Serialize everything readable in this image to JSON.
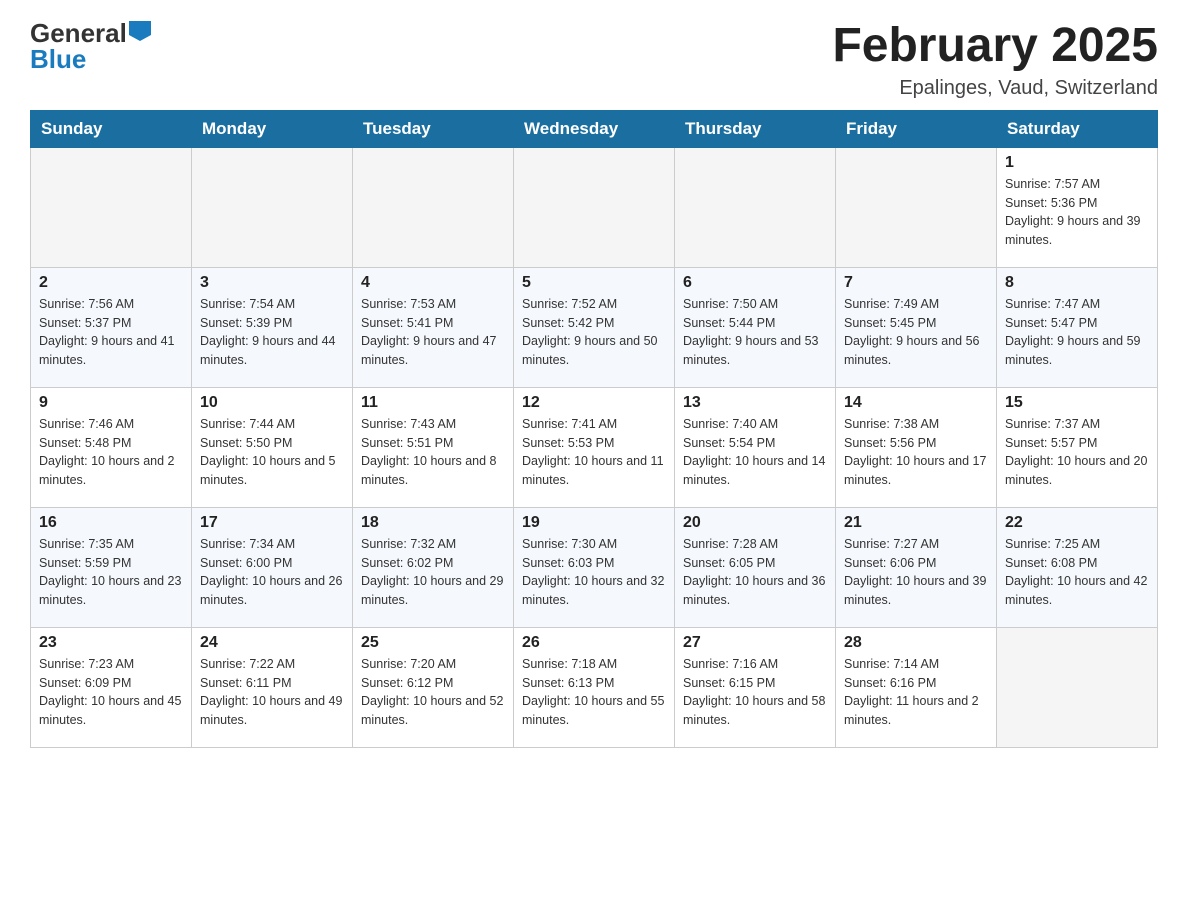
{
  "header": {
    "logo_general": "General",
    "logo_blue": "Blue",
    "month_title": "February 2025",
    "location": "Epalinges, Vaud, Switzerland"
  },
  "weekdays": [
    "Sunday",
    "Monday",
    "Tuesday",
    "Wednesday",
    "Thursday",
    "Friday",
    "Saturday"
  ],
  "weeks": [
    [
      {
        "day": "",
        "info": ""
      },
      {
        "day": "",
        "info": ""
      },
      {
        "day": "",
        "info": ""
      },
      {
        "day": "",
        "info": ""
      },
      {
        "day": "",
        "info": ""
      },
      {
        "day": "",
        "info": ""
      },
      {
        "day": "1",
        "info": "Sunrise: 7:57 AM\nSunset: 5:36 PM\nDaylight: 9 hours and 39 minutes."
      }
    ],
    [
      {
        "day": "2",
        "info": "Sunrise: 7:56 AM\nSunset: 5:37 PM\nDaylight: 9 hours and 41 minutes."
      },
      {
        "day": "3",
        "info": "Sunrise: 7:54 AM\nSunset: 5:39 PM\nDaylight: 9 hours and 44 minutes."
      },
      {
        "day": "4",
        "info": "Sunrise: 7:53 AM\nSunset: 5:41 PM\nDaylight: 9 hours and 47 minutes."
      },
      {
        "day": "5",
        "info": "Sunrise: 7:52 AM\nSunset: 5:42 PM\nDaylight: 9 hours and 50 minutes."
      },
      {
        "day": "6",
        "info": "Sunrise: 7:50 AM\nSunset: 5:44 PM\nDaylight: 9 hours and 53 minutes."
      },
      {
        "day": "7",
        "info": "Sunrise: 7:49 AM\nSunset: 5:45 PM\nDaylight: 9 hours and 56 minutes."
      },
      {
        "day": "8",
        "info": "Sunrise: 7:47 AM\nSunset: 5:47 PM\nDaylight: 9 hours and 59 minutes."
      }
    ],
    [
      {
        "day": "9",
        "info": "Sunrise: 7:46 AM\nSunset: 5:48 PM\nDaylight: 10 hours and 2 minutes."
      },
      {
        "day": "10",
        "info": "Sunrise: 7:44 AM\nSunset: 5:50 PM\nDaylight: 10 hours and 5 minutes."
      },
      {
        "day": "11",
        "info": "Sunrise: 7:43 AM\nSunset: 5:51 PM\nDaylight: 10 hours and 8 minutes."
      },
      {
        "day": "12",
        "info": "Sunrise: 7:41 AM\nSunset: 5:53 PM\nDaylight: 10 hours and 11 minutes."
      },
      {
        "day": "13",
        "info": "Sunrise: 7:40 AM\nSunset: 5:54 PM\nDaylight: 10 hours and 14 minutes."
      },
      {
        "day": "14",
        "info": "Sunrise: 7:38 AM\nSunset: 5:56 PM\nDaylight: 10 hours and 17 minutes."
      },
      {
        "day": "15",
        "info": "Sunrise: 7:37 AM\nSunset: 5:57 PM\nDaylight: 10 hours and 20 minutes."
      }
    ],
    [
      {
        "day": "16",
        "info": "Sunrise: 7:35 AM\nSunset: 5:59 PM\nDaylight: 10 hours and 23 minutes."
      },
      {
        "day": "17",
        "info": "Sunrise: 7:34 AM\nSunset: 6:00 PM\nDaylight: 10 hours and 26 minutes."
      },
      {
        "day": "18",
        "info": "Sunrise: 7:32 AM\nSunset: 6:02 PM\nDaylight: 10 hours and 29 minutes."
      },
      {
        "day": "19",
        "info": "Sunrise: 7:30 AM\nSunset: 6:03 PM\nDaylight: 10 hours and 32 minutes."
      },
      {
        "day": "20",
        "info": "Sunrise: 7:28 AM\nSunset: 6:05 PM\nDaylight: 10 hours and 36 minutes."
      },
      {
        "day": "21",
        "info": "Sunrise: 7:27 AM\nSunset: 6:06 PM\nDaylight: 10 hours and 39 minutes."
      },
      {
        "day": "22",
        "info": "Sunrise: 7:25 AM\nSunset: 6:08 PM\nDaylight: 10 hours and 42 minutes."
      }
    ],
    [
      {
        "day": "23",
        "info": "Sunrise: 7:23 AM\nSunset: 6:09 PM\nDaylight: 10 hours and 45 minutes."
      },
      {
        "day": "24",
        "info": "Sunrise: 7:22 AM\nSunset: 6:11 PM\nDaylight: 10 hours and 49 minutes."
      },
      {
        "day": "25",
        "info": "Sunrise: 7:20 AM\nSunset: 6:12 PM\nDaylight: 10 hours and 52 minutes."
      },
      {
        "day": "26",
        "info": "Sunrise: 7:18 AM\nSunset: 6:13 PM\nDaylight: 10 hours and 55 minutes."
      },
      {
        "day": "27",
        "info": "Sunrise: 7:16 AM\nSunset: 6:15 PM\nDaylight: 10 hours and 58 minutes."
      },
      {
        "day": "28",
        "info": "Sunrise: 7:14 AM\nSunset: 6:16 PM\nDaylight: 11 hours and 2 minutes."
      },
      {
        "day": "",
        "info": ""
      }
    ]
  ]
}
